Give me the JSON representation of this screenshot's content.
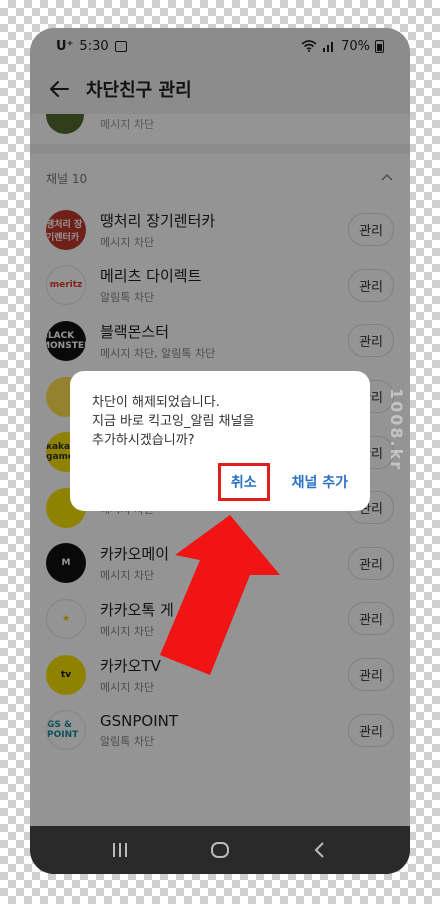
{
  "status_bar": {
    "carrier": "U⁺",
    "time": "5:30",
    "battery": "70%"
  },
  "header": {
    "title": "차단친구 관리"
  },
  "previous_item": {
    "sub": "메시지 차단"
  },
  "section": {
    "label": "채널 10"
  },
  "channels": [
    {
      "name": "땡처리 장기렌터카",
      "sub": "메시지 차단",
      "button": "관리",
      "logo_bg": "#c0392b",
      "logo_text": "땡처리 장기렌터카",
      "logo_color": "#ffffff"
    },
    {
      "name": "메리츠 다이렉트",
      "sub": "알림톡 차단",
      "button": "관리",
      "logo_bg": "#ffffff",
      "logo_text": "meritz",
      "logo_color": "#e03a2f"
    },
    {
      "name": "블랙몬스터",
      "sub": "메시지 차단, 알림톡 차단",
      "button": "관리",
      "logo_bg": "#111111",
      "logo_text": "BLACK MONSTER",
      "logo_color": "#ffffff"
    },
    {
      "name": "",
      "sub": "",
      "button": "관리",
      "logo_bg": "#ffe14d",
      "logo_text": "",
      "logo_color": "#333333"
    },
    {
      "name": "",
      "sub": "",
      "button": "관리",
      "logo_bg": "#f7e000",
      "logo_text": "kakao games",
      "logo_color": "#333333"
    },
    {
      "name": "",
      "sub": "메시지 차단",
      "button": "관리",
      "logo_bg": "#f7e000",
      "logo_text": "",
      "logo_color": "#6a3fa0"
    },
    {
      "name": "카카오메이",
      "sub": "메시지 차단",
      "button": "관리",
      "logo_bg": "#111111",
      "logo_text": "M",
      "logo_color": "#ffffff"
    },
    {
      "name": "카카오톡 게",
      "sub": "메시지 차단",
      "button": "관리",
      "logo_bg": "#ffffff",
      "logo_text": "★",
      "logo_color": "#f2c200"
    },
    {
      "name": "카카오TV",
      "sub": "메시지 차단",
      "button": "관리",
      "logo_bg": "#f7e000",
      "logo_text": "tv",
      "logo_color": "#111111"
    },
    {
      "name": "GSNPOINT",
      "sub": "알림톡 차단",
      "button": "관리",
      "logo_bg": "#ffffff",
      "logo_text": "GS & POINT",
      "logo_color": "#1a8c9c"
    }
  ],
  "dialog": {
    "line1": "차단이 해제되었습니다.",
    "line2": "지금 바로 킥고잉_알림 채널을",
    "line3": "추가하시겠습니까?",
    "cancel": "취소",
    "add": "채널 추가"
  },
  "watermark": "1008.kr"
}
